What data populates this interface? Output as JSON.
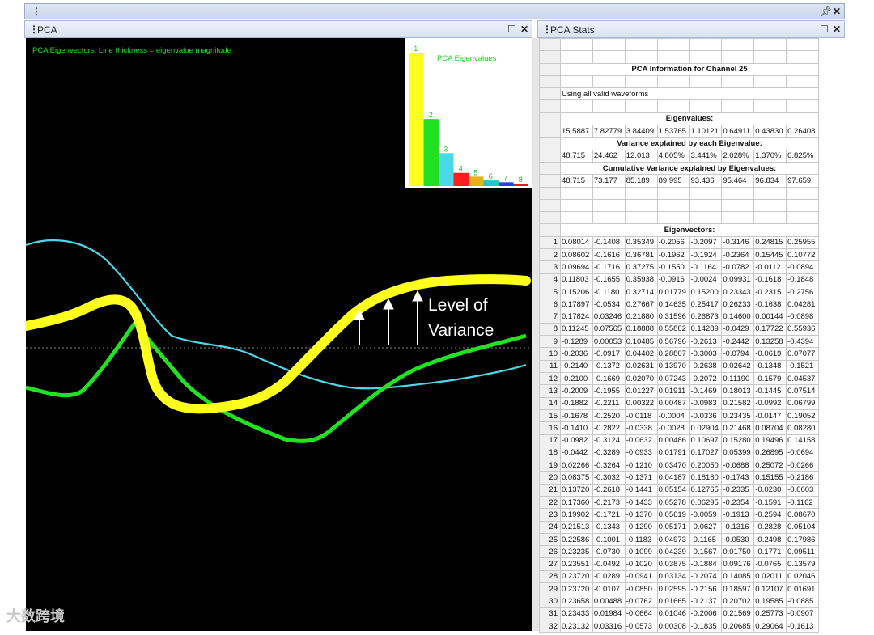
{
  "topbar": {
    "pin_icon": "pin-icon",
    "close_icon": "close-icon"
  },
  "pca_pane": {
    "title": "PCA",
    "caption": "PCA Eigenvectors. Line thickness = eigenvalue magnitude",
    "annotation_line1": "Level of",
    "annotation_line2": "Variance",
    "inset_title": "PCA Eigenvalues",
    "colors": {
      "eig1": "#ffff1e",
      "eig2": "#22e122",
      "eig3": "#4bd8e8",
      "caption": "#22dd22"
    }
  },
  "stats_pane": {
    "title": "PCA Stats",
    "heading": "PCA Information for Channel 25",
    "note": "Using all valid waveforms",
    "eigenvalues_label": "Eigenvalues:",
    "eigenvalues": [
      "15.5887",
      "7.82779",
      "3.84409",
      "1.53765",
      "1.10121",
      "0.64911",
      "0.43830",
      "0.26408"
    ],
    "variance_label": "Variance explained by each Eigenvalue:",
    "variance": [
      "48.715",
      "24.462",
      "12.013",
      "4.805%",
      "3.441%",
      "2.028%",
      "1.370%",
      "0.825%"
    ],
    "cumulative_label": "Cumulative Variance explained by Eigenvalues:",
    "cumulative": [
      "48.715",
      "73.177",
      "85.189",
      "89.995",
      "93.436",
      "95.464",
      "96.834",
      "97.659"
    ],
    "eigenvectors_label": "Eigenvectors:",
    "eigenvectors": [
      [
        "0.08014",
        "-0.1408",
        "0.35349",
        "-0.2056",
        "-0.2097",
        "-0.3146",
        "0.24815",
        "0.25955"
      ],
      [
        "0.08602",
        "-0.1616",
        "0.36781",
        "-0.1962",
        "-0.1924",
        "-0.2364",
        "0.15445",
        "0.10772"
      ],
      [
        "0.09694",
        "-0.1716",
        "0.37275",
        "-0.1550",
        "-0.1164",
        "-0.0782",
        "-0.0112",
        "-0.0894"
      ],
      [
        "0.11803",
        "-0.1655",
        "0.35938",
        "-0.0916",
        "-0.0024",
        "0.09931",
        "-0.1618",
        "-0.1848"
      ],
      [
        "0.15206",
        "-0.1180",
        "0.32714",
        "0.01779",
        "0.15200",
        "0.23343",
        "-0.2315",
        "-0.2756"
      ],
      [
        "0.17897",
        "-0.0534",
        "0.27667",
        "0.14635",
        "0.25417",
        "0.26233",
        "-0.1638",
        "0.04281"
      ],
      [
        "0.17824",
        "0.03246",
        "0.21880",
        "0.31596",
        "0.26873",
        "0.14600",
        "0.00144",
        "-0.0898"
      ],
      [
        "0.11245",
        "0.07565",
        "0.18888",
        "0.55862",
        "0.14289",
        "-0.0429",
        "0.17722",
        "0.55936"
      ],
      [
        "-0.1289",
        "0.00053",
        "0.10485",
        "0.56796",
        "-0.2613",
        "-0.2442",
        "0.13258",
        "-0.4394"
      ],
      [
        "-0.2036",
        "-0.0917",
        "0.04402",
        "0.28807",
        "-0.3003",
        "-0.0794",
        "-0.0619",
        "0.07077"
      ],
      [
        "-0.2140",
        "-0.1372",
        "0.02631",
        "0.13970",
        "-0.2638",
        "0.02642",
        "-0.1348",
        "-0.1521"
      ],
      [
        "-0.2100",
        "-0.1669",
        "0.02070",
        "0.07243",
        "-0.2072",
        "0.11190",
        "-0.1579",
        "0.04537"
      ],
      [
        "-0.2009",
        "-0.1955",
        "0.01227",
        "0.01911",
        "-0.1469",
        "0.18013",
        "-0.1445",
        "0.07514"
      ],
      [
        "-0.1882",
        "-0.2211",
        "0.00322",
        "0.00487",
        "-0.0983",
        "0.21582",
        "-0.0992",
        "0.06799"
      ],
      [
        "-0.1678",
        "-0.2520",
        "-0.0118",
        "-0.0004",
        "-0.0336",
        "0.23435",
        "-0.0147",
        "0.19052"
      ],
      [
        "-0.1410",
        "-0.2822",
        "-0.0338",
        "-0.0028",
        "0.02904",
        "0.21468",
        "0.08704",
        "0.08280"
      ],
      [
        "-0.0982",
        "-0.3124",
        "-0.0632",
        "0.00486",
        "0.10697",
        "0.15280",
        "0.19496",
        "0.14158"
      ],
      [
        "-0.0442",
        "-0.3289",
        "-0.0933",
        "0.01791",
        "0.17027",
        "0.05399",
        "0.26895",
        "-0.0694"
      ],
      [
        "0.02266",
        "-0.3264",
        "-0.1210",
        "0.03470",
        "0.20050",
        "-0.0688",
        "0.25072",
        "-0.0266"
      ],
      [
        "0.08375",
        "-0.3032",
        "-0.1371",
        "0.04187",
        "0.18160",
        "-0.1743",
        "0.15155",
        "-0.2186"
      ],
      [
        "0.13720",
        "-0.2618",
        "-0.1441",
        "0.05154",
        "0.12765",
        "-0.2335",
        "-0.0230",
        "-0.0603"
      ],
      [
        "0.17360",
        "-0.2173",
        "-0.1433",
        "0.05278",
        "0.06295",
        "-0.2354",
        "-0.1591",
        "-0.1162"
      ],
      [
        "0.19902",
        "-0.1721",
        "-0.1370",
        "0.05619",
        "-0.0059",
        "-0.1913",
        "-0.2594",
        "0.08670"
      ],
      [
        "0.21513",
        "-0.1343",
        "-0.1290",
        "0.05171",
        "-0.0627",
        "-0.1316",
        "-0.2828",
        "0.05104"
      ],
      [
        "0.22586",
        "-0.1001",
        "-0.1183",
        "0.04973",
        "-0.1165",
        "-0.0530",
        "-0.2498",
        "0.17986"
      ],
      [
        "0.23235",
        "-0.0730",
        "-0.1099",
        "0.04239",
        "-0.1567",
        "0.01750",
        "-0.1771",
        "0.09511"
      ],
      [
        "0.23551",
        "-0.0492",
        "-0.1020",
        "0.03875",
        "-0.1884",
        "0.09176",
        "-0.0765",
        "0.13579"
      ],
      [
        "0.23720",
        "-0.0289",
        "-0.0941",
        "0.03134",
        "-0.2074",
        "0.14085",
        "0.02011",
        "0.02046"
      ],
      [
        "0.23720",
        "-0.0107",
        "-0.0850",
        "0.02595",
        "-0.2156",
        "0.18597",
        "0.12107",
        "0.01691"
      ],
      [
        "0.23658",
        "0.00488",
        "-0.0762",
        "0.01665",
        "-0.2137",
        "0.20702",
        "0.19585",
        "-0.0885"
      ],
      [
        "0.23433",
        "0.01984",
        "-0.0664",
        "0.01046",
        "-0.2006",
        "0.21569",
        "0.25773",
        "-0.0907"
      ],
      [
        "0.23132",
        "0.03316",
        "-0.0573",
        "0.00308",
        "-0.1835",
        "0.20685",
        "0.29064",
        "-0.1613"
      ]
    ]
  },
  "watermark": "大数跨境"
}
